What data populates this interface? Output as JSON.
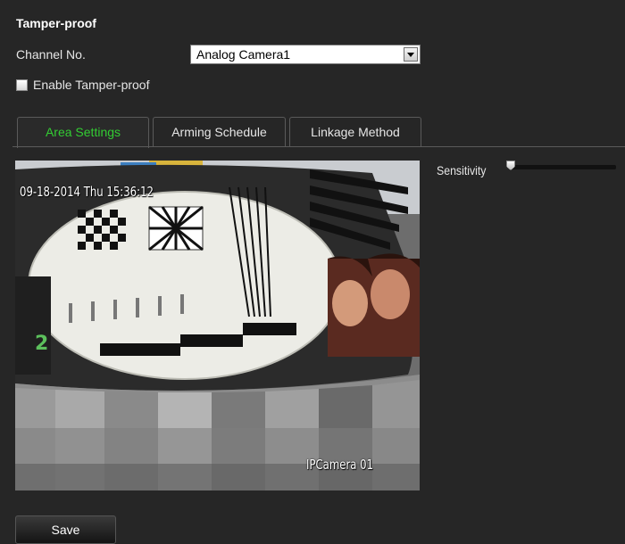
{
  "page": {
    "title": "Tamper-proof"
  },
  "channel": {
    "label": "Channel No.",
    "selected": "Analog Camera1"
  },
  "enable": {
    "label": "Enable Tamper-proof",
    "checked": false
  },
  "tabs": [
    {
      "label": "Area Settings",
      "active": true
    },
    {
      "label": "Arming Schedule",
      "active": false
    },
    {
      "label": "Linkage Method",
      "active": false
    }
  ],
  "video": {
    "timestamp": "09-18-2014 Thu 15:36:12",
    "camera_name": "IPCamera 01"
  },
  "sensitivity": {
    "label": "Sensitivity",
    "value": 0.0
  },
  "actions": {
    "save_label": "Save"
  },
  "colors": {
    "background": "#262626",
    "active_tab_text": "#33cc33",
    "text": "#e6e6e6"
  }
}
